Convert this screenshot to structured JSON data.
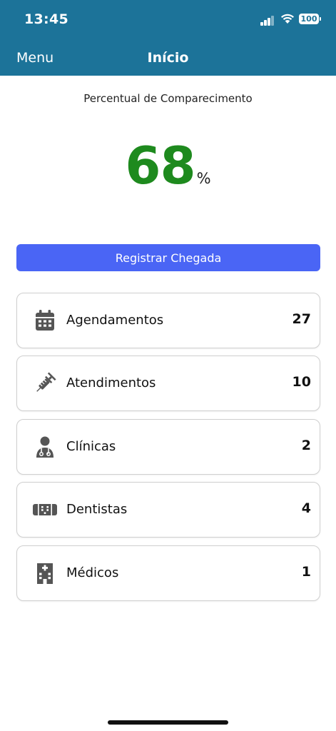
{
  "status_bar": {
    "time": "13:45",
    "battery": "100"
  },
  "nav": {
    "menu_label": "Menu",
    "title": "Início",
    "background_color": "#1c7399"
  },
  "attendance": {
    "subtitle": "Percentual de Comparecimento",
    "value": "68",
    "unit": "%",
    "value_color": "#1e8a1e"
  },
  "register_button": {
    "label": "Registrar Chegada",
    "color": "#4a65f5"
  },
  "cards": [
    {
      "icon": "calendar-icon",
      "label": "Agendamentos",
      "count": "27"
    },
    {
      "icon": "syringe-icon",
      "label": "Atendimentos",
      "count": "10"
    },
    {
      "icon": "doctor-icon",
      "label": "Clínicas",
      "count": "2"
    },
    {
      "icon": "tooth-icon",
      "label": "Dentistas",
      "count": "4"
    },
    {
      "icon": "hospital-icon",
      "label": "Médicos",
      "count": "1"
    }
  ]
}
